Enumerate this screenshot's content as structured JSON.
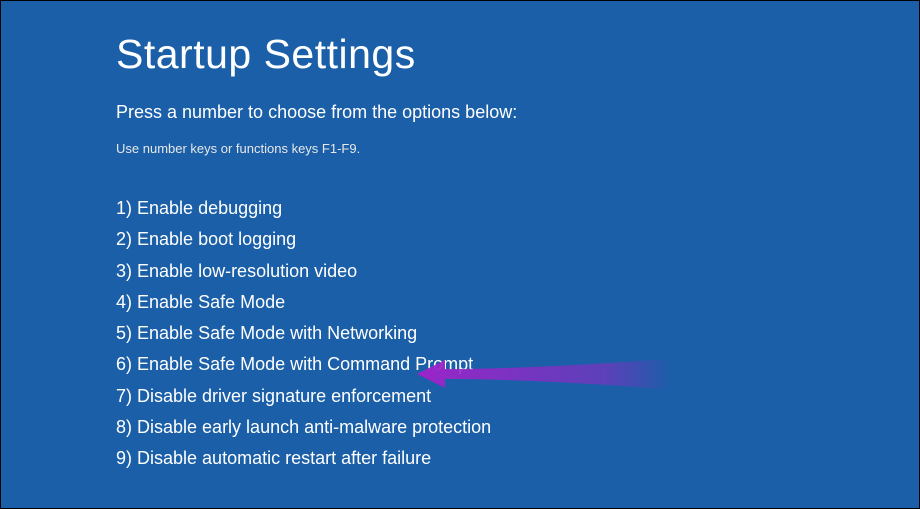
{
  "title": "Startup Settings",
  "subtitle": "Press a number to choose from the options below:",
  "hint": "Use number keys or functions keys F1-F9.",
  "options": [
    {
      "num": "1",
      "label": "Enable debugging"
    },
    {
      "num": "2",
      "label": "Enable boot logging"
    },
    {
      "num": "3",
      "label": "Enable low-resolution video"
    },
    {
      "num": "4",
      "label": "Enable Safe Mode"
    },
    {
      "num": "5",
      "label": "Enable Safe Mode with Networking"
    },
    {
      "num": "6",
      "label": "Enable Safe Mode with Command Prompt"
    },
    {
      "num": "7",
      "label": "Disable driver signature enforcement"
    },
    {
      "num": "8",
      "label": "Disable early launch anti-malware protection"
    },
    {
      "num": "9",
      "label": "Disable automatic restart after failure"
    }
  ],
  "arrow_color": "#9b24c9"
}
